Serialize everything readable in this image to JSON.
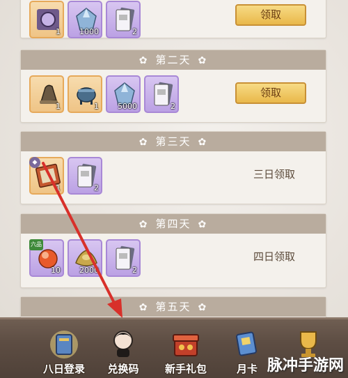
{
  "days": [
    {
      "header": "",
      "items": [
        {
          "icon": "compass-icon",
          "qty": "1",
          "rarity": "orange"
        },
        {
          "icon": "crystal-icon",
          "qty": "1000",
          "rarity": "purple"
        },
        {
          "icon": "scroll-card-icon",
          "qty": "2",
          "rarity": "purple"
        }
      ],
      "action": {
        "type": "button",
        "label": "领取"
      }
    },
    {
      "header": "第二天",
      "items": [
        {
          "icon": "bell-icon",
          "qty": "1",
          "rarity": "orange"
        },
        {
          "icon": "cauldron-icon",
          "qty": "1",
          "rarity": "purple"
        },
        {
          "icon": "crystal-icon",
          "qty": "5000",
          "rarity": "purple"
        },
        {
          "icon": "scroll-card-icon",
          "qty": "2",
          "rarity": "purple"
        }
      ],
      "action": {
        "type": "button",
        "label": "领取"
      }
    },
    {
      "header": "第三天",
      "items": [
        {
          "icon": "treasure-map-icon",
          "qty": "1",
          "rarity": "orange"
        },
        {
          "icon": "scroll-card-icon",
          "qty": "2",
          "rarity": "purple"
        }
      ],
      "action": {
        "type": "text",
        "label": "三日领取"
      }
    },
    {
      "header": "第四天",
      "items": [
        {
          "icon": "orb-icon",
          "qty": "10",
          "rarity": "purple"
        },
        {
          "icon": "ingot-icon",
          "qty": "2000",
          "rarity": "purple"
        },
        {
          "icon": "scroll-card-icon",
          "qty": "2",
          "rarity": "purple"
        }
      ],
      "action": {
        "type": "text",
        "label": "四日领取"
      }
    },
    {
      "header": "第五天"
    }
  ],
  "tags": {
    "grade_six": "六品"
  },
  "nav": [
    {
      "label": "八日登录",
      "icon": "eight-day-login-icon"
    },
    {
      "label": "兑换码",
      "icon": "redeem-code-character-icon"
    },
    {
      "label": "新手礼包",
      "icon": "gift-box-icon"
    },
    {
      "label": "月卡",
      "icon": "month-card-icon"
    },
    {
      "label": "",
      "icon": "trophy-icon"
    }
  ],
  "watermark": "脉冲手游网",
  "colors": {
    "header": "#b9ac9e",
    "button": "#e9b84a",
    "arrow": "#d8302a"
  }
}
